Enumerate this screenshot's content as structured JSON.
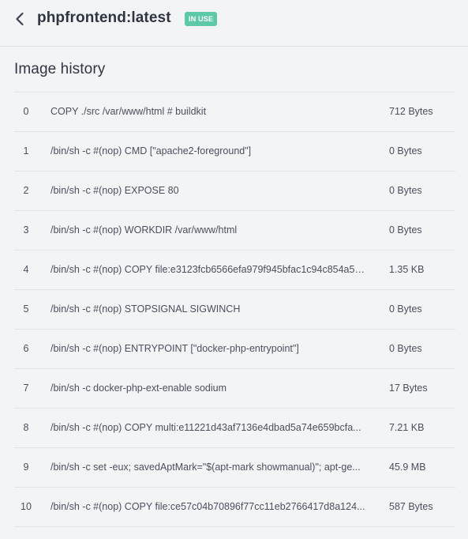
{
  "header": {
    "title": "phpfrontend:latest",
    "badge": "IN USE",
    "back_icon": "chevron-left-icon",
    "badge_color": "#5ec9a7"
  },
  "history": {
    "title": "Image history",
    "rows": [
      {
        "index": "0",
        "command": "COPY ./src /var/www/html # buildkit",
        "size": "712 Bytes"
      },
      {
        "index": "1",
        "command": "/bin/sh -c #(nop) CMD [\"apache2-foreground\"]",
        "size": "0 Bytes"
      },
      {
        "index": "2",
        "command": "/bin/sh -c #(nop) EXPOSE 80",
        "size": "0 Bytes"
      },
      {
        "index": "3",
        "command": "/bin/sh -c #(nop) WORKDIR /var/www/html",
        "size": "0 Bytes"
      },
      {
        "index": "4",
        "command": "/bin/sh -c #(nop) COPY file:e3123fcb6566efa979f945bfac1c94c854a55...",
        "size": "1.35 KB"
      },
      {
        "index": "5",
        "command": "/bin/sh -c #(nop) STOPSIGNAL SIGWINCH",
        "size": "0 Bytes"
      },
      {
        "index": "6",
        "command": "/bin/sh -c #(nop) ENTRYPOINT [\"docker-php-entrypoint\"]",
        "size": "0 Bytes"
      },
      {
        "index": "7",
        "command": "/bin/sh -c docker-php-ext-enable sodium",
        "size": "17 Bytes"
      },
      {
        "index": "8",
        "command": "/bin/sh -c #(nop) COPY multi:e11221d43af7136e4dbad5a74e659bcfa...",
        "size": "7.21 KB"
      },
      {
        "index": "9",
        "command": "/bin/sh -c set -eux; savedAptMark=\"$(apt-mark showmanual)\"; apt-ge...",
        "size": "45.9 MB"
      },
      {
        "index": "10",
        "command": "/bin/sh -c #(nop) COPY file:ce57c04b70896f77cc11eb2766417d8a124...",
        "size": "587 Bytes"
      }
    ]
  }
}
